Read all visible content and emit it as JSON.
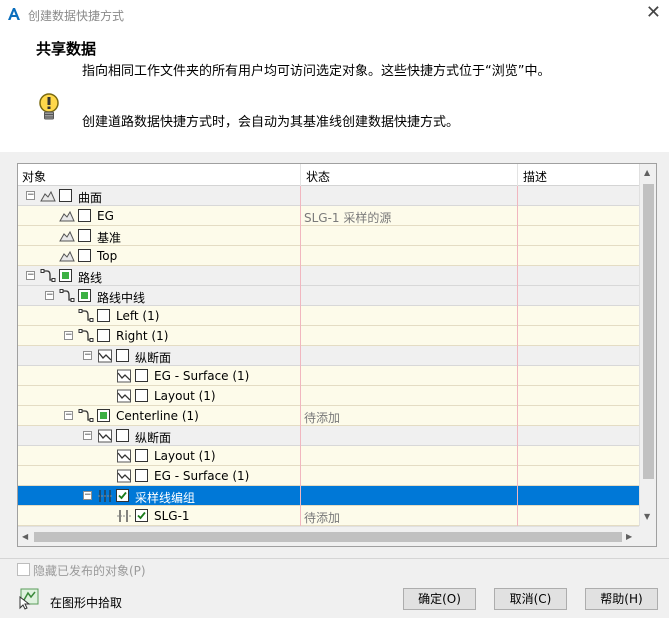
{
  "window": {
    "title": "创建数据快捷方式",
    "close": "✕"
  },
  "header": {
    "title": "共享数据",
    "description1": "指向相同工作文件夹的所有用户均可访问选定对象。这些快捷方式位于“浏览”中。",
    "description2": "创建道路数据快捷方式时，会自动为其基准线创建数据快捷方式。"
  },
  "columns": {
    "object": "对象",
    "status": "状态",
    "description": "描述"
  },
  "tree": {
    "rows": [
      {
        "label": "曲面",
        "status": "",
        "icon": "surface-icon",
        "check": "none"
      },
      {
        "label": "EG",
        "status": "SLG-1 采样的源",
        "icon": "surface-icon",
        "check": "none"
      },
      {
        "label": "基准",
        "status": "",
        "icon": "surface-icon",
        "check": "none"
      },
      {
        "label": "Top",
        "status": "",
        "icon": "surface-icon",
        "check": "none"
      },
      {
        "label": "路线",
        "status": "",
        "icon": "alignment-icon",
        "check": "partial"
      },
      {
        "label": "路线中线",
        "status": "",
        "icon": "alignment-icon",
        "check": "partial"
      },
      {
        "label": "Left (1)",
        "status": "",
        "icon": "alignment-icon",
        "check": "none"
      },
      {
        "label": "Right (1)",
        "status": "",
        "icon": "alignment-icon",
        "check": "none"
      },
      {
        "label": "纵断面",
        "status": "",
        "icon": "profile-icon",
        "check": "none"
      },
      {
        "label": "EG - Surface (1)",
        "status": "",
        "icon": "profile-icon",
        "check": "none"
      },
      {
        "label": "Layout (1)",
        "status": "",
        "icon": "profile-icon",
        "check": "none"
      },
      {
        "label": "Centerline (1)",
        "status": "待添加",
        "icon": "alignment-icon",
        "check": "partial"
      },
      {
        "label": "纵断面",
        "status": "",
        "icon": "profile-icon",
        "check": "none"
      },
      {
        "label": "Layout (1)",
        "status": "",
        "icon": "profile-icon",
        "check": "none"
      },
      {
        "label": "EG - Surface (1)",
        "status": "",
        "icon": "profile-icon",
        "check": "none"
      },
      {
        "label": "采样线编组",
        "status": "",
        "icon": "sample-line-group-icon",
        "check": "checked"
      },
      {
        "label": "SLG-1",
        "status": "待添加",
        "icon": "sample-line-icon",
        "check": "checked"
      }
    ]
  },
  "footer": {
    "hide_published": "隐藏已发布的对象(P)",
    "pick_in_drawing": "在图形中拾取",
    "ok": "确定(O)",
    "cancel": "取消(C)",
    "help": "帮助(H)"
  },
  "colors": {
    "selection": "#0078d7",
    "row_highlight": "#fdfbea",
    "group_row": "#f0f0f0",
    "column_divider": "#f1b6bf",
    "check_green": "#3cb043"
  }
}
